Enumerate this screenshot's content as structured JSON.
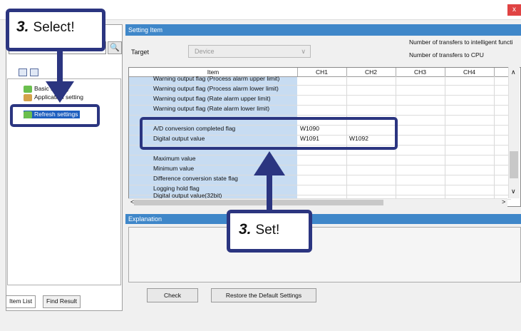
{
  "window": {
    "close_label": "x"
  },
  "left_panel": {
    "tree": [
      {
        "label": "Basic setting"
      },
      {
        "label": "Application setting"
      },
      {
        "label": "Refresh settings"
      }
    ],
    "tabs": [
      "Item List",
      "Find Result"
    ]
  },
  "setting_item": {
    "header": "Setting Item",
    "target_label": "Target",
    "target_value": "Device",
    "transfer_intelligent": "Number of transfers to intelligent functi",
    "transfer_cpu": "Number of transfers to CPU"
  },
  "grid": {
    "columns": [
      "Item",
      "CH1",
      "CH2",
      "CH3",
      "CH4"
    ],
    "rows": [
      {
        "item": "Warning output flag (Process alarm upper limit)",
        "ch1": "",
        "ch2": ""
      },
      {
        "item": "Warning output flag (Process alarm lower limit)",
        "ch1": "",
        "ch2": ""
      },
      {
        "item": "Warning output flag (Rate alarm upper limit)",
        "ch1": "",
        "ch2": ""
      },
      {
        "item": "Warning output flag (Rate alarm lower limit)",
        "ch1": "",
        "ch2": ""
      },
      {
        "item": "",
        "ch1": "",
        "ch2": ""
      },
      {
        "item": "A/D conversion completed flag",
        "ch1": "W1090",
        "ch2": ""
      },
      {
        "item": "Digital output value",
        "ch1": "W1091",
        "ch2": "W1092"
      },
      {
        "item": "",
        "ch1": "",
        "ch2": ""
      },
      {
        "item": "Maximum value",
        "ch1": "",
        "ch2": ""
      },
      {
        "item": "Minimum value",
        "ch1": "",
        "ch2": ""
      },
      {
        "item": "Difference conversion state flag",
        "ch1": "",
        "ch2": ""
      },
      {
        "item": "Logging hold flag",
        "ch1": "",
        "ch2": ""
      },
      {
        "item": "Digital output value(32bit)",
        "ch1": "",
        "ch2": ""
      }
    ]
  },
  "explanation": {
    "header": "Explanation"
  },
  "buttons": {
    "check": "Check",
    "restore": "Restore the Default Settings"
  },
  "callouts": {
    "select": {
      "num": "3.",
      "text": "Select!"
    },
    "set": {
      "num": "3.",
      "text": "Set!"
    }
  },
  "colors": {
    "accent": "#3f87c9",
    "callout": "#2b3580",
    "item_column": "#c7dcf2"
  }
}
